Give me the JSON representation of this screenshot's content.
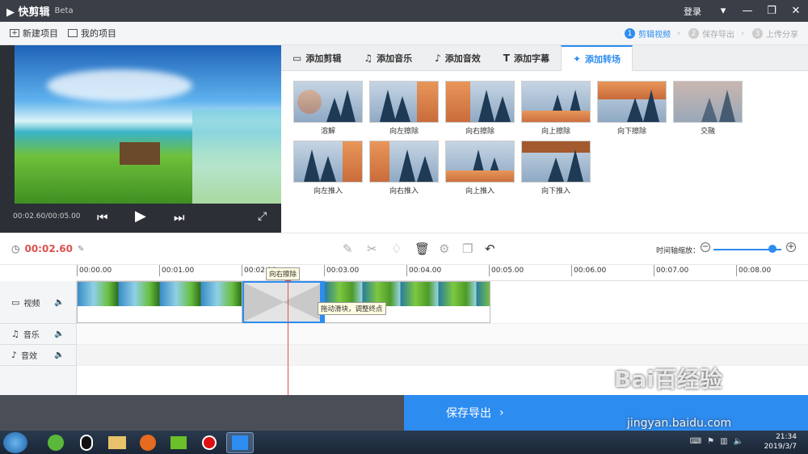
{
  "app": {
    "title": "快剪辑",
    "badge": "Beta",
    "login": "登录"
  },
  "window_controls": {
    "menu": "▾",
    "minimize": "—",
    "maximize": "❐",
    "close": "✕"
  },
  "toolbar": {
    "new_project": "新建项目",
    "my_projects": "我的项目"
  },
  "steps": [
    {
      "num": "1",
      "label": "剪辑视频"
    },
    {
      "num": "2",
      "label": "保存导出"
    },
    {
      "num": "3",
      "label": "上传分享"
    }
  ],
  "preview": {
    "time": "00:02.60/00:05.00"
  },
  "tabs": [
    {
      "icon": "▭",
      "label": "添加剪辑"
    },
    {
      "icon": "♫",
      "label": "添加音乐"
    },
    {
      "icon": "♪",
      "label": "添加音效"
    },
    {
      "icon": "T",
      "label": "添加字幕"
    },
    {
      "icon": "✦",
      "label": "添加转场"
    }
  ],
  "transitions": [
    "溶解",
    "向左擦除",
    "向右擦除",
    "向上擦除",
    "向下擦除",
    "交融",
    "向左推入",
    "向右推入",
    "向上推入",
    "向下推入"
  ],
  "editbar": {
    "current_time": "00:02.60",
    "zoom_label": "时间轴缩放：",
    "zoom_level": 0.85
  },
  "ruler": [
    "00:00.00",
    "00:01.00",
    "00:02.00",
    "00:03.00",
    "00:04.00",
    "00:05.00",
    "00:06.00",
    "00:07.00",
    "00:08.00"
  ],
  "tracks": {
    "video": "视频",
    "music": "音乐",
    "sfx": "音效"
  },
  "tooltips": {
    "transition_name": "向右擦除",
    "drag_hint": "拖动滑块，调整终点"
  },
  "save_button": "保存导出",
  "taskbar": {
    "time": "21:34",
    "date": "2019/3/7"
  },
  "watermark": {
    "line1": "Bai百经验",
    "line2": "jingyan.baidu.com"
  },
  "colors": {
    "accent": "#2d8cf0",
    "playhead": "#d9534f"
  }
}
